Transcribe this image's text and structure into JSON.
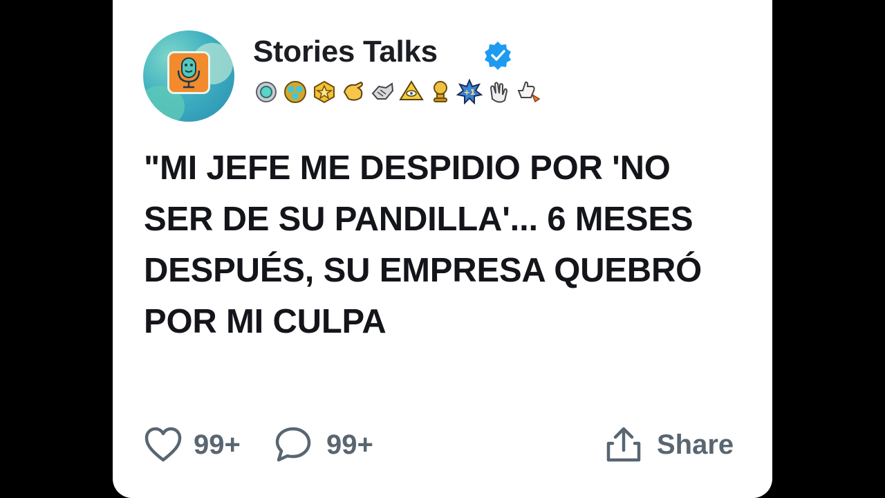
{
  "post": {
    "author": "Stories Talks",
    "verified": true,
    "headline": "\"MI JEFE ME DESPIDIO POR 'NO SER DE SU PANDILLA'... 6 MESES DESPUÉS, SU EMPRESA QUEBRÓ POR MI CULPA",
    "likes": "99+",
    "comments": "99+",
    "share_label": "Share"
  },
  "badges": [
    "ring-award-icon",
    "gem-cluster-award-icon",
    "star-award-icon",
    "pointing-hand-award-icon",
    "handshake-award-icon",
    "pyramid-eye-award-icon",
    "gold-trophy-award-icon",
    "plus-one-award-icon",
    "clapping-hands-award-icon",
    "rocket-thumbs-up-award-icon"
  ],
  "colors": {
    "background": "#000000",
    "card": "#ffffff",
    "text": "#14151a",
    "muted": "#596671",
    "verified": "#1d9bf0"
  }
}
